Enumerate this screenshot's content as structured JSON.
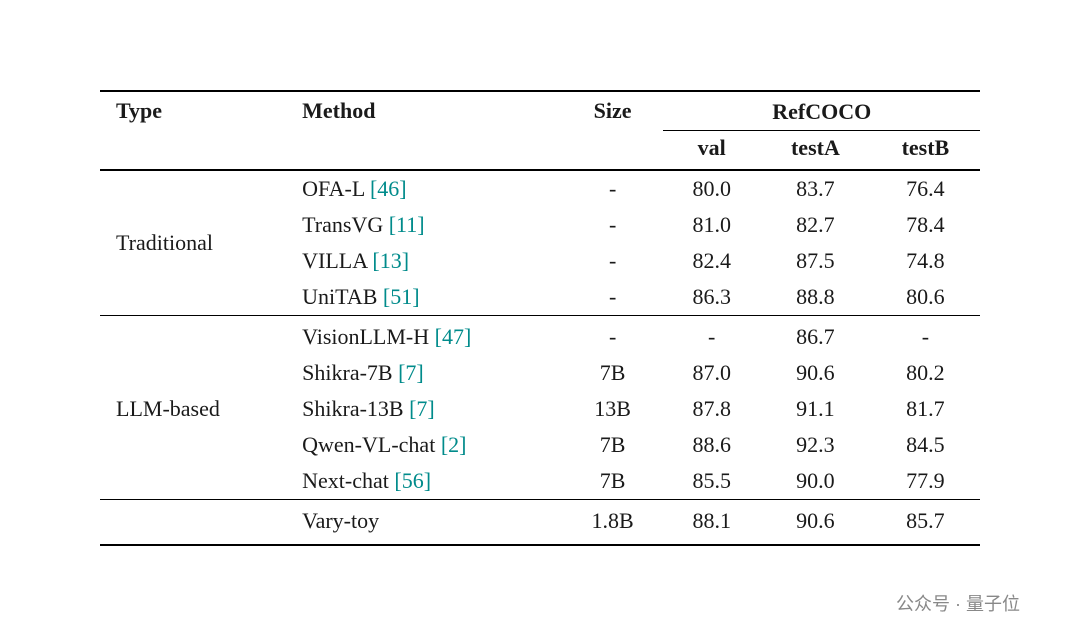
{
  "table": {
    "title": "RefCOCO",
    "columns": {
      "type": "Type",
      "method": "Method",
      "size": "Size",
      "val": "val",
      "testA": "testA",
      "testB": "testB"
    },
    "sections": [
      {
        "type": "Traditional",
        "rows": [
          {
            "method": "OFA-L ",
            "cite": "[46]",
            "size": "-",
            "val": "80.0",
            "testA": "83.7",
            "testB": "76.4"
          },
          {
            "method": "TransVG ",
            "cite": "[11]",
            "size": "-",
            "val": "81.0",
            "testA": "82.7",
            "testB": "78.4"
          },
          {
            "method": "VILLA ",
            "cite": "[13]",
            "size": "-",
            "val": "82.4",
            "testA": "87.5",
            "testB": "74.8"
          },
          {
            "method": "UniTAB ",
            "cite": "[51]",
            "size": "-",
            "val": "86.3",
            "testA": "88.8",
            "testB": "80.6"
          }
        ]
      },
      {
        "type": "LLM-based",
        "rows": [
          {
            "method": "VisionLLM-H ",
            "cite": "[47]",
            "size": "-",
            "val": "-",
            "testA": "86.7",
            "testB": "-"
          },
          {
            "method": "Shikra-7B ",
            "cite": "[7]",
            "size": "7B",
            "val": "87.0",
            "testA": "90.6",
            "testB": "80.2"
          },
          {
            "method": "Shikra-13B ",
            "cite": "[7]",
            "size": "13B",
            "val": "87.8",
            "testA": "91.1",
            "testB": "81.7"
          },
          {
            "method": "Qwen-VL-chat ",
            "cite": "[2]",
            "size": "7B",
            "val": "88.6",
            "testA": "92.3",
            "testB": "84.5"
          },
          {
            "method": "Next-chat ",
            "cite": "[56]",
            "size": "7B",
            "val": "85.5",
            "testA": "90.0",
            "testB": "77.9"
          }
        ]
      },
      {
        "type": "",
        "rows": [
          {
            "method": "Vary-toy",
            "cite": "",
            "size": "1.8B",
            "val": "88.1",
            "testA": "90.6",
            "testB": "85.7"
          }
        ]
      }
    ],
    "watermark": "公众号 · 量子位"
  }
}
